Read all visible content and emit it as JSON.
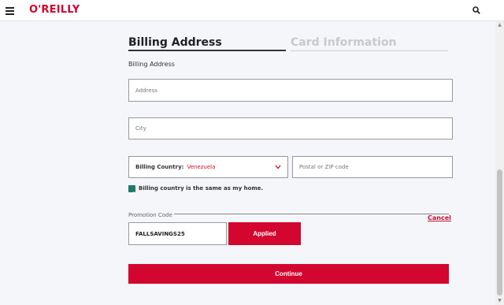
{
  "header": {
    "logo": "O'REILLY",
    "menu_icon": "hamburger-menu-icon",
    "search_icon": "search-icon",
    "brand_color": "#d3002d"
  },
  "tabs": [
    {
      "label": "Billing Address",
      "active": true
    },
    {
      "label": "Card Information",
      "active": false
    }
  ],
  "form": {
    "section_label": "Billing Address",
    "address": {
      "placeholder": "Address",
      "value": ""
    },
    "city": {
      "placeholder": "City",
      "value": ""
    },
    "country": {
      "label": "Billing Country:",
      "value": "Venezuela"
    },
    "postal": {
      "placeholder": "Postal or ZIP code",
      "value": ""
    },
    "same_as_home": {
      "label": "Billing country is the same as my home.",
      "checked": true,
      "color": "#1f7a66"
    }
  },
  "promotion": {
    "label": "Promotion Code",
    "cancel_label": "Cancel",
    "code": "FALLSAVINGS25",
    "applied_label": "Applied"
  },
  "actions": {
    "continue_label": "Continue",
    "accent_color": "#d3062f"
  }
}
